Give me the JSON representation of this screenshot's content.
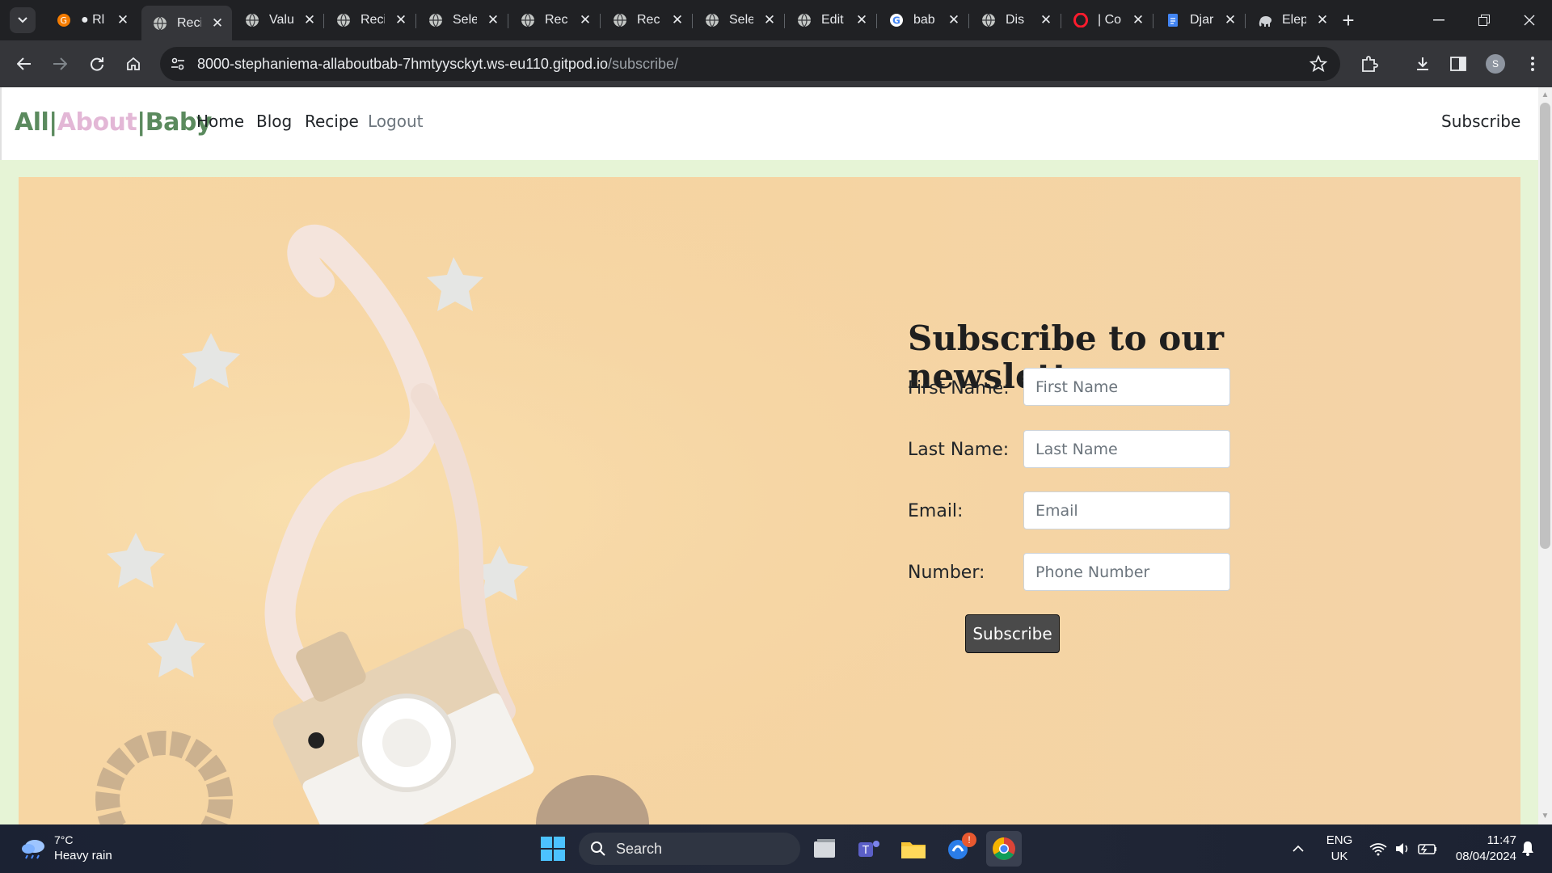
{
  "browser": {
    "tabs": [
      {
        "title": "● Rl",
        "icon": "grammarly-icon"
      },
      {
        "title": "Reci",
        "icon": "globe-icon",
        "active": true
      },
      {
        "title": "Valu",
        "icon": "globe-icon"
      },
      {
        "title": "Reci",
        "icon": "globe-icon"
      },
      {
        "title": "Sele",
        "icon": "globe-icon"
      },
      {
        "title": "Rec",
        "icon": "globe-icon"
      },
      {
        "title": "Rec",
        "icon": "globe-icon"
      },
      {
        "title": "Sele",
        "icon": "globe-icon"
      },
      {
        "title": "Edit",
        "icon": "globe-icon"
      },
      {
        "title": "bab",
        "icon": "google-icon"
      },
      {
        "title": "Dis",
        "icon": "globe-icon"
      },
      {
        "title": "| Co",
        "icon": "opera-icon"
      },
      {
        "title": "Djar",
        "icon": "docs-icon"
      },
      {
        "title": "Elep",
        "icon": "elephant-icon"
      }
    ],
    "url_host": "8000-stephaniema-allaboutbab-7hmtyysckyt.ws-eu110.gitpod.io",
    "url_path": "/subscribe/",
    "profile_initial": "S"
  },
  "site": {
    "brand": {
      "part1": "All|",
      "part2": "About",
      "part3": "|Baby"
    },
    "nav": {
      "home": "Home",
      "blog": "Blog",
      "recipe": "Recipe",
      "logout": "Logout",
      "subscribe": "Subscribe"
    },
    "form": {
      "heading": "Subscribe to our newsletter:",
      "first_name_label": "First Name:",
      "first_name_placeholder": "First Name",
      "last_name_label": "Last Name:",
      "last_name_placeholder": "Last Name",
      "email_label": "Email:",
      "email_placeholder": "Email",
      "number_label": "Number:",
      "number_placeholder": "Phone Number",
      "submit_label": "Subscribe"
    }
  },
  "taskbar": {
    "weather_temp": "7°C",
    "weather_desc": "Heavy rain",
    "search_label": "Search",
    "lang_line1": "ENG",
    "lang_line2": "UK",
    "time": "11:47",
    "date": "08/04/2024",
    "notification_badge": "!"
  }
}
